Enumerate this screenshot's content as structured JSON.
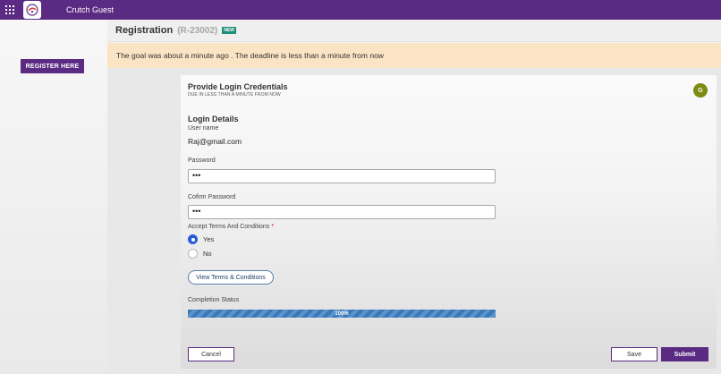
{
  "topbar": {
    "app_title": "Crutch Guest",
    "menu_icon": "grid-menu-icon",
    "logo_icon": "app-logo-icon",
    "color": "#5b2a82"
  },
  "sidebar": {
    "register_button": "REGISTER HERE"
  },
  "header": {
    "title": "Registration",
    "record_id": "(R-23002)",
    "badge": "NEW"
  },
  "notice": {
    "text": "The goal was about a minute ago . The deadline is less than a minute from now",
    "color": "#fbe4c3"
  },
  "card": {
    "title": "Provide Login Credentials",
    "subtitle": "DUE IN LESS THAN A MINUTE FROM NOW",
    "avatar_initial": "G",
    "avatar_color": "#7d8b14"
  },
  "login": {
    "section_title": "Login Details",
    "username_label": "User name",
    "username_value": "Raj@gmail.com",
    "password_label": "Password",
    "password_value": "•••",
    "confirm_label": "Cofirm Password",
    "confirm_value": "•••",
    "terms_label": "Accept Terms And Conditions",
    "terms_required_mark": "*",
    "options": [
      {
        "label": "Yes",
        "checked": true
      },
      {
        "label": "No",
        "checked": false
      }
    ],
    "view_terms_button": "View Terms & Conditions"
  },
  "completion": {
    "label": "Completion Status",
    "percent_text": "100%",
    "value": 1.0
  },
  "actions": {
    "cancel": "Cancel",
    "save": "Save",
    "submit": "Submit"
  }
}
